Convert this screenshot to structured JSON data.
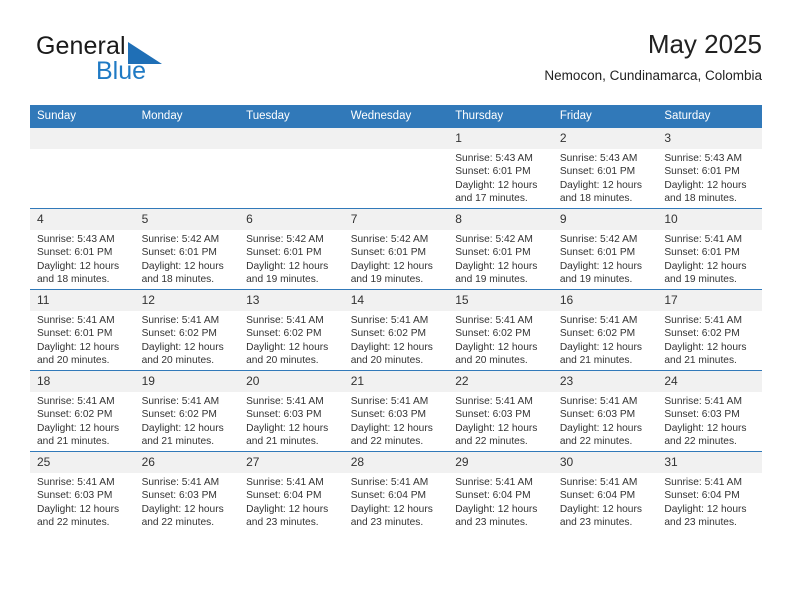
{
  "brand": {
    "name_top": "General",
    "name_bottom": "Blue",
    "accent_color": "#1f7ac4",
    "triangle_color": "#1f6fb6"
  },
  "header": {
    "title": "May 2025",
    "subtitle": "Nemocon, Cundinamarca, Colombia"
  },
  "theme": {
    "header_bg": "#3179b9",
    "header_text": "#ffffff",
    "daynum_bg": "#f1f1f1",
    "row_border": "#3179b9"
  },
  "weekdays": [
    "Sunday",
    "Monday",
    "Tuesday",
    "Wednesday",
    "Thursday",
    "Friday",
    "Saturday"
  ],
  "labels": {
    "sunrise_prefix": "Sunrise: ",
    "sunset_prefix": "Sunset: ",
    "daylight_prefix": "Daylight: "
  },
  "weeks": [
    [
      {
        "day": "",
        "sunrise": "",
        "sunset": "",
        "daylight_line1": "",
        "daylight_line2": ""
      },
      {
        "day": "",
        "sunrise": "",
        "sunset": "",
        "daylight_line1": "",
        "daylight_line2": ""
      },
      {
        "day": "",
        "sunrise": "",
        "sunset": "",
        "daylight_line1": "",
        "daylight_line2": ""
      },
      {
        "day": "",
        "sunrise": "",
        "sunset": "",
        "daylight_line1": "",
        "daylight_line2": ""
      },
      {
        "day": "1",
        "sunrise": "Sunrise: 5:43 AM",
        "sunset": "Sunset: 6:01 PM",
        "daylight_line1": "Daylight: 12 hours",
        "daylight_line2": "and 17 minutes."
      },
      {
        "day": "2",
        "sunrise": "Sunrise: 5:43 AM",
        "sunset": "Sunset: 6:01 PM",
        "daylight_line1": "Daylight: 12 hours",
        "daylight_line2": "and 18 minutes."
      },
      {
        "day": "3",
        "sunrise": "Sunrise: 5:43 AM",
        "sunset": "Sunset: 6:01 PM",
        "daylight_line1": "Daylight: 12 hours",
        "daylight_line2": "and 18 minutes."
      }
    ],
    [
      {
        "day": "4",
        "sunrise": "Sunrise: 5:43 AM",
        "sunset": "Sunset: 6:01 PM",
        "daylight_line1": "Daylight: 12 hours",
        "daylight_line2": "and 18 minutes."
      },
      {
        "day": "5",
        "sunrise": "Sunrise: 5:42 AM",
        "sunset": "Sunset: 6:01 PM",
        "daylight_line1": "Daylight: 12 hours",
        "daylight_line2": "and 18 minutes."
      },
      {
        "day": "6",
        "sunrise": "Sunrise: 5:42 AM",
        "sunset": "Sunset: 6:01 PM",
        "daylight_line1": "Daylight: 12 hours",
        "daylight_line2": "and 19 minutes."
      },
      {
        "day": "7",
        "sunrise": "Sunrise: 5:42 AM",
        "sunset": "Sunset: 6:01 PM",
        "daylight_line1": "Daylight: 12 hours",
        "daylight_line2": "and 19 minutes."
      },
      {
        "day": "8",
        "sunrise": "Sunrise: 5:42 AM",
        "sunset": "Sunset: 6:01 PM",
        "daylight_line1": "Daylight: 12 hours",
        "daylight_line2": "and 19 minutes."
      },
      {
        "day": "9",
        "sunrise": "Sunrise: 5:42 AM",
        "sunset": "Sunset: 6:01 PM",
        "daylight_line1": "Daylight: 12 hours",
        "daylight_line2": "and 19 minutes."
      },
      {
        "day": "10",
        "sunrise": "Sunrise: 5:41 AM",
        "sunset": "Sunset: 6:01 PM",
        "daylight_line1": "Daylight: 12 hours",
        "daylight_line2": "and 19 minutes."
      }
    ],
    [
      {
        "day": "11",
        "sunrise": "Sunrise: 5:41 AM",
        "sunset": "Sunset: 6:01 PM",
        "daylight_line1": "Daylight: 12 hours",
        "daylight_line2": "and 20 minutes."
      },
      {
        "day": "12",
        "sunrise": "Sunrise: 5:41 AM",
        "sunset": "Sunset: 6:02 PM",
        "daylight_line1": "Daylight: 12 hours",
        "daylight_line2": "and 20 minutes."
      },
      {
        "day": "13",
        "sunrise": "Sunrise: 5:41 AM",
        "sunset": "Sunset: 6:02 PM",
        "daylight_line1": "Daylight: 12 hours",
        "daylight_line2": "and 20 minutes."
      },
      {
        "day": "14",
        "sunrise": "Sunrise: 5:41 AM",
        "sunset": "Sunset: 6:02 PM",
        "daylight_line1": "Daylight: 12 hours",
        "daylight_line2": "and 20 minutes."
      },
      {
        "day": "15",
        "sunrise": "Sunrise: 5:41 AM",
        "sunset": "Sunset: 6:02 PM",
        "daylight_line1": "Daylight: 12 hours",
        "daylight_line2": "and 20 minutes."
      },
      {
        "day": "16",
        "sunrise": "Sunrise: 5:41 AM",
        "sunset": "Sunset: 6:02 PM",
        "daylight_line1": "Daylight: 12 hours",
        "daylight_line2": "and 21 minutes."
      },
      {
        "day": "17",
        "sunrise": "Sunrise: 5:41 AM",
        "sunset": "Sunset: 6:02 PM",
        "daylight_line1": "Daylight: 12 hours",
        "daylight_line2": "and 21 minutes."
      }
    ],
    [
      {
        "day": "18",
        "sunrise": "Sunrise: 5:41 AM",
        "sunset": "Sunset: 6:02 PM",
        "daylight_line1": "Daylight: 12 hours",
        "daylight_line2": "and 21 minutes."
      },
      {
        "day": "19",
        "sunrise": "Sunrise: 5:41 AM",
        "sunset": "Sunset: 6:02 PM",
        "daylight_line1": "Daylight: 12 hours",
        "daylight_line2": "and 21 minutes."
      },
      {
        "day": "20",
        "sunrise": "Sunrise: 5:41 AM",
        "sunset": "Sunset: 6:03 PM",
        "daylight_line1": "Daylight: 12 hours",
        "daylight_line2": "and 21 minutes."
      },
      {
        "day": "21",
        "sunrise": "Sunrise: 5:41 AM",
        "sunset": "Sunset: 6:03 PM",
        "daylight_line1": "Daylight: 12 hours",
        "daylight_line2": "and 22 minutes."
      },
      {
        "day": "22",
        "sunrise": "Sunrise: 5:41 AM",
        "sunset": "Sunset: 6:03 PM",
        "daylight_line1": "Daylight: 12 hours",
        "daylight_line2": "and 22 minutes."
      },
      {
        "day": "23",
        "sunrise": "Sunrise: 5:41 AM",
        "sunset": "Sunset: 6:03 PM",
        "daylight_line1": "Daylight: 12 hours",
        "daylight_line2": "and 22 minutes."
      },
      {
        "day": "24",
        "sunrise": "Sunrise: 5:41 AM",
        "sunset": "Sunset: 6:03 PM",
        "daylight_line1": "Daylight: 12 hours",
        "daylight_line2": "and 22 minutes."
      }
    ],
    [
      {
        "day": "25",
        "sunrise": "Sunrise: 5:41 AM",
        "sunset": "Sunset: 6:03 PM",
        "daylight_line1": "Daylight: 12 hours",
        "daylight_line2": "and 22 minutes."
      },
      {
        "day": "26",
        "sunrise": "Sunrise: 5:41 AM",
        "sunset": "Sunset: 6:03 PM",
        "daylight_line1": "Daylight: 12 hours",
        "daylight_line2": "and 22 minutes."
      },
      {
        "day": "27",
        "sunrise": "Sunrise: 5:41 AM",
        "sunset": "Sunset: 6:04 PM",
        "daylight_line1": "Daylight: 12 hours",
        "daylight_line2": "and 23 minutes."
      },
      {
        "day": "28",
        "sunrise": "Sunrise: 5:41 AM",
        "sunset": "Sunset: 6:04 PM",
        "daylight_line1": "Daylight: 12 hours",
        "daylight_line2": "and 23 minutes."
      },
      {
        "day": "29",
        "sunrise": "Sunrise: 5:41 AM",
        "sunset": "Sunset: 6:04 PM",
        "daylight_line1": "Daylight: 12 hours",
        "daylight_line2": "and 23 minutes."
      },
      {
        "day": "30",
        "sunrise": "Sunrise: 5:41 AM",
        "sunset": "Sunset: 6:04 PM",
        "daylight_line1": "Daylight: 12 hours",
        "daylight_line2": "and 23 minutes."
      },
      {
        "day": "31",
        "sunrise": "Sunrise: 5:41 AM",
        "sunset": "Sunset: 6:04 PM",
        "daylight_line1": "Daylight: 12 hours",
        "daylight_line2": "and 23 minutes."
      }
    ]
  ]
}
